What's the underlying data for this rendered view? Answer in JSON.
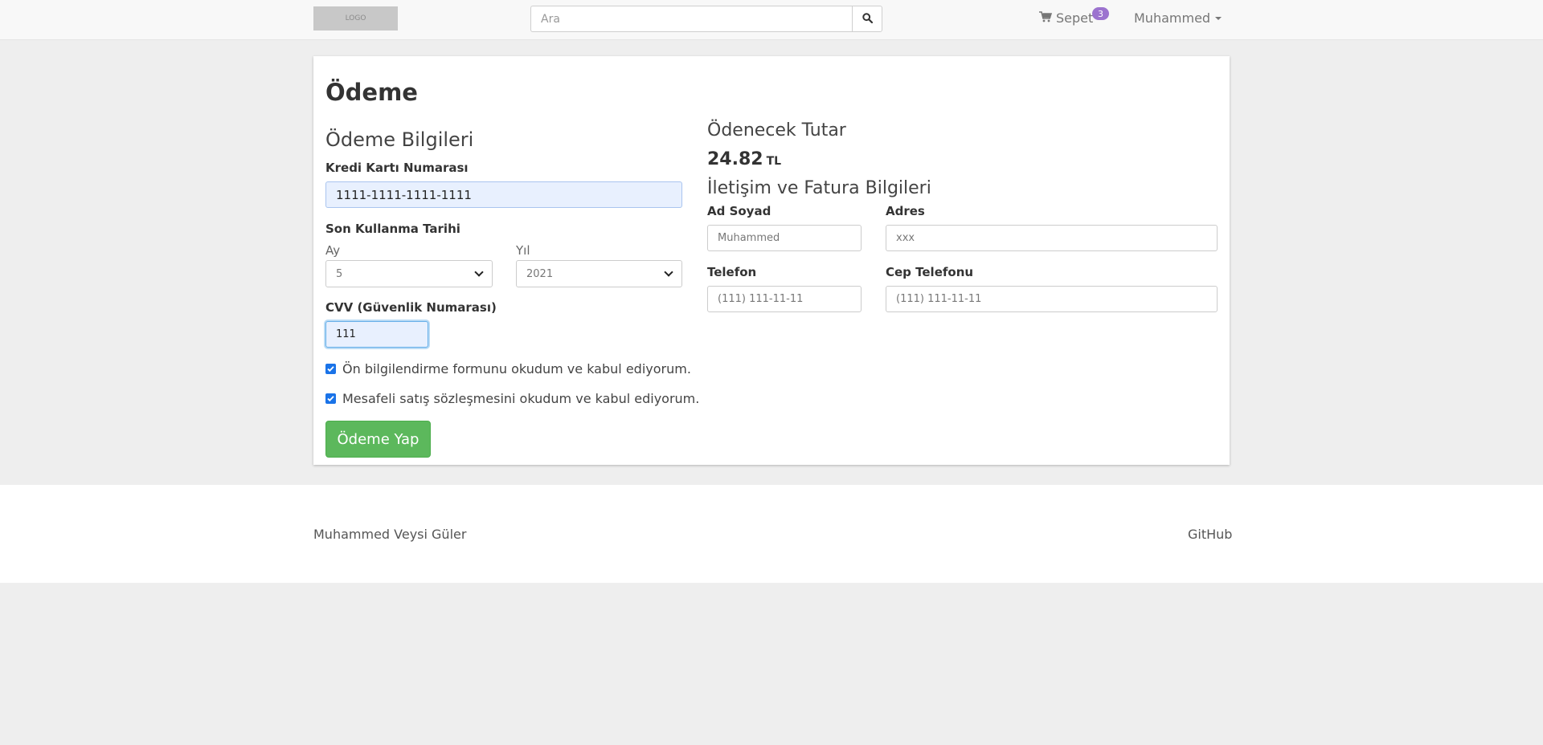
{
  "nav": {
    "logo_text": "LOGO",
    "search_placeholder": "Ara",
    "cart_label": "Sepet",
    "cart_count": "3",
    "user_name": "Muhammed"
  },
  "page": {
    "title": "Ödeme",
    "payment_section_title": "Ödeme Bilgileri",
    "card_number_label": "Kredi Kartı Numarası",
    "card_number_value": "1111-1111-1111-1111",
    "expiry_label": "Son Kullanma Tarihi",
    "month_label": "Ay",
    "month_value": "5",
    "year_label": "Yıl",
    "year_value": "2021",
    "cvv_label": "CVV (Güvenlik Numarası)",
    "cvv_value": "111",
    "agree_info_form": "Ön bilgilendirme formunu okudum ve kabul ediyorum.",
    "agree_distance_sales": "Mesafeli satış sözleşmesini okudum ve kabul ediyorum.",
    "pay_button": "Ödeme Yap",
    "amount_title": "Ödenecek Tutar",
    "amount_value": "24.82",
    "amount_currency": "TL",
    "contact_section_title": "İletişim ve Fatura Bilgileri",
    "name_label": "Ad Soyad",
    "name_placeholder": "Muhammed",
    "address_label": "Adres",
    "address_placeholder": "xxx",
    "phone_label": "Telefon",
    "phone_placeholder": "(111) 111-11-11",
    "mobile_label": "Cep Telefonu",
    "mobile_placeholder": "(111) 111-11-11"
  },
  "footer": {
    "author": "Muhammed Veysi Güler",
    "github": "GitHub"
  },
  "colors": {
    "pay_button": "#5cb85c",
    "cart_badge": "#9c73cf",
    "autofill_background": "#e8f0fe"
  },
  "icons": {
    "search": "search-icon",
    "cart": "shopping-cart-icon",
    "user_caret": "caret-down-icon"
  }
}
